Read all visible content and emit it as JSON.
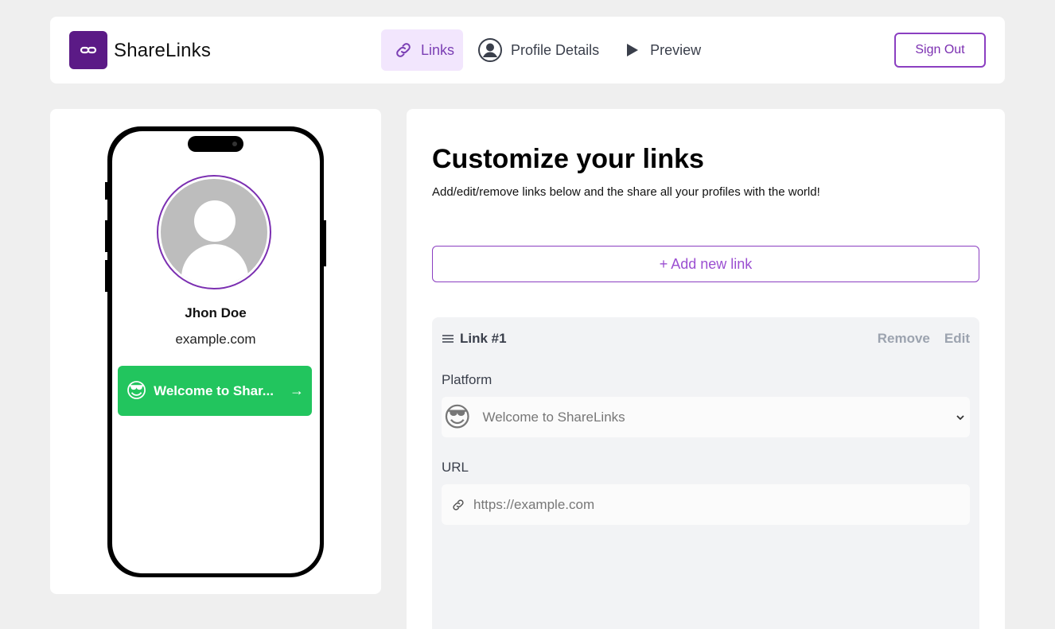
{
  "header": {
    "brand": "ShareLinks",
    "nav": [
      {
        "label": "Links",
        "icon": "link-icon",
        "active": true
      },
      {
        "label": "Profile Details",
        "icon": "user-circle-icon",
        "active": false
      },
      {
        "label": "Preview",
        "icon": "play-icon",
        "active": false
      }
    ],
    "signout_label": "Sign Out"
  },
  "preview": {
    "name": "Jhon Doe",
    "site": "example.com",
    "link_emoji": "😎",
    "link_text": "Welcome to Shar...",
    "link_arrow": "→"
  },
  "editor": {
    "title": "Customize your links",
    "subtitle": "Add/edit/remove links below and the share all your profiles with the world!",
    "add_label": "+ Add new link",
    "card": {
      "heading": "Link #1",
      "remove": "Remove",
      "edit": "Edit",
      "platform_label": "Platform",
      "platform_emoji": "😎",
      "platform_value": "Welcome to ShareLinks",
      "url_label": "URL",
      "url_placeholder": "https://example.com"
    }
  },
  "colors": {
    "brand": "#5b1a86",
    "accent": "#8b3fc1",
    "link_button": "#22c55e",
    "active_nav_bg": "#f2e6fd"
  }
}
